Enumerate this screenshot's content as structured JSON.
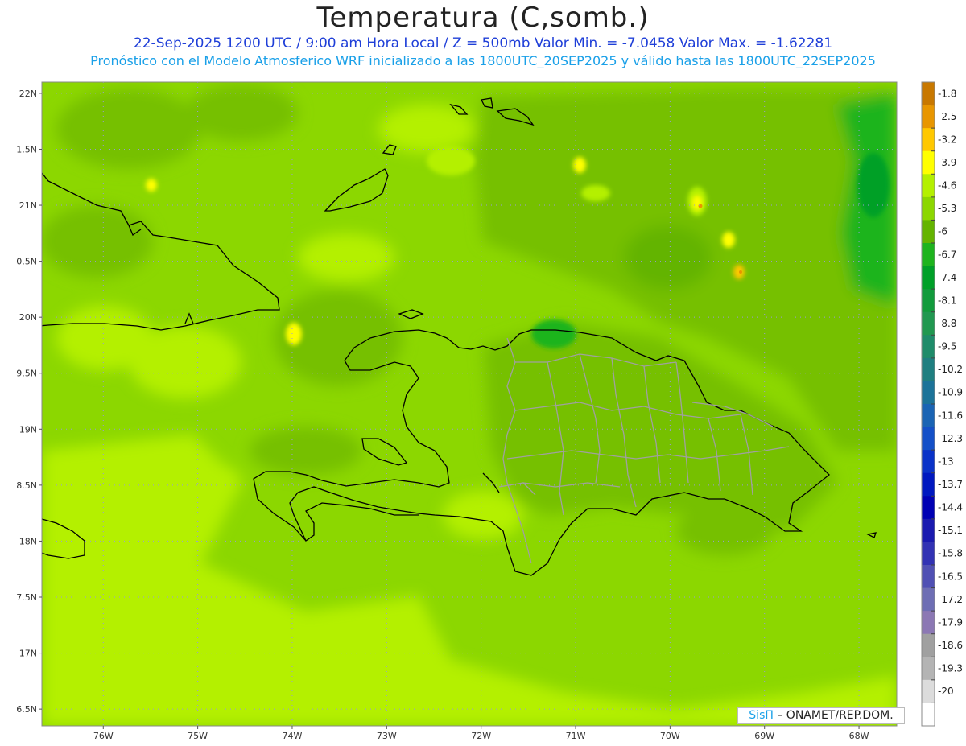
{
  "header": {
    "title": "Temperatura (C,somb.)",
    "subtitle_line1": "22-Sep-2025  1200 UTC / 9:00 am Hora Local / Z = 500mb   Valor Min. = -7.0458  Valor Max. = -1.62281",
    "subtitle_line2": "Pronóstico con el Modelo Atmosferico WRF inicializado a las 1800UTC_20SEP2025 y válido hasta las  1800UTC_22SEP2025"
  },
  "chart_data": {
    "type": "heatmap",
    "variable": "Temperatura (C,somb.)",
    "level": "500mb",
    "value_min": -7.0458,
    "value_max": -1.62281,
    "lon_range": [
      -76.65,
      -67.6
    ],
    "lat_range": [
      16.35,
      22.1
    ],
    "x_ticks": [
      "76W",
      "75W",
      "74W",
      "73W",
      "72W",
      "71W",
      "70W",
      "69W",
      "68W"
    ],
    "x_tick_values": [
      -76,
      -75,
      -74,
      -73,
      -72,
      -71,
      -70,
      -69,
      -68
    ],
    "y_ticks": [
      "22N",
      "1.5N",
      "21N",
      "0.5N",
      "20N",
      "9.5N",
      "19N",
      "8.5N",
      "18N",
      "7.5N",
      "17N",
      "6.5N"
    ],
    "y_tick_values": [
      22,
      21.5,
      21,
      20.5,
      20,
      19.5,
      19,
      18.5,
      18,
      17.5,
      17,
      16.5
    ],
    "colorbar": {
      "labels": [
        "-1.8",
        "-2.5",
        "-3.2",
        "-3.9",
        "-4.6",
        "-5.3",
        "-6",
        "-6.7",
        "-7.4",
        "-8.1",
        "-8.8",
        "-9.5",
        "-10.2",
        "-10.9",
        "-11.6",
        "-12.3",
        "-13",
        "-13.7",
        "-14.4",
        "-15.1",
        "-15.8",
        "-16.5",
        "-17.2",
        "-17.9",
        "-18.6",
        "-19.3",
        "-20"
      ],
      "colors": [
        "#c87800",
        "#e89600",
        "#ffc800",
        "#ffff00",
        "#b4f000",
        "#8cd700",
        "#64b400",
        "#1eb41e",
        "#00a028",
        "#129b3c",
        "#219850",
        "#1f8c6a",
        "#1f7f80",
        "#1c7399",
        "#1a64b4",
        "#1450c8",
        "#0a32c8",
        "#0018c0",
        "#0000b4",
        "#1a1ab0",
        "#3232b4",
        "#5050b4",
        "#6e6eb4",
        "#8c78b4",
        "#a0a0a0",
        "#b4b4b4",
        "#dcdcdc",
        "#ffffff"
      ]
    }
  },
  "credit": {
    "brand": "SisΠ",
    "text": "– ONAMET/REP.DOM."
  }
}
